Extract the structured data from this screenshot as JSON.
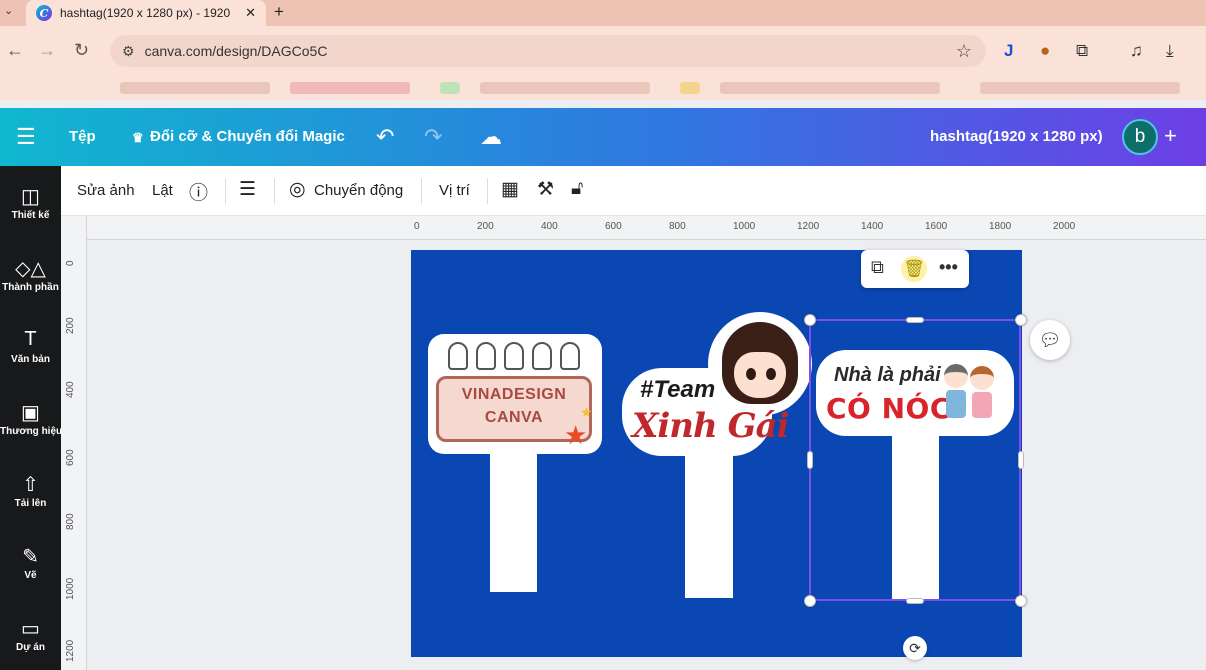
{
  "browser": {
    "tab_title": "hashtag(1920 x 1280 px) - 1920",
    "tab_close": "✕",
    "new_tab": "+",
    "url": "canva.com/design/DAGCo5C"
  },
  "topbar": {
    "menu_icon": "☰",
    "file": "Tệp",
    "magic_resize": "Đổi cỡ & Chuyển đổi Magic",
    "design_title": "hashtag(1920 x 1280 px)",
    "avatar_letter": "b",
    "add": "+"
  },
  "sidebar": {
    "items": [
      {
        "label": "Thiết kế",
        "icon": "layout-icon"
      },
      {
        "label": "Thành phần",
        "icon": "elements-icon"
      },
      {
        "label": "Văn bản",
        "icon": "text-icon"
      },
      {
        "label": "Thương hiệu",
        "icon": "brand-icon"
      },
      {
        "label": "Tải lên",
        "icon": "upload-icon"
      },
      {
        "label": "Vẽ",
        "icon": "draw-icon"
      },
      {
        "label": "Dự án",
        "icon": "folder-icon"
      }
    ]
  },
  "toolbar": {
    "edit_photo": "Sửa ảnh",
    "flip": "Lật",
    "animate": "Chuyển động",
    "position": "Vị trí"
  },
  "ruler": {
    "h_ticks": [
      "0",
      "200",
      "400",
      "600",
      "800",
      "1000",
      "1200",
      "1400",
      "1600",
      "1800",
      "2000"
    ],
    "v_ticks": [
      "0",
      "200",
      "400",
      "600",
      "800",
      "1000",
      "1200"
    ]
  },
  "stickers": {
    "sign1_line1": "VINADESIGN",
    "sign1_line2": "CANVA",
    "sign2_line1": "#Team",
    "sign2_line2": "Xinh Gái",
    "sign3_line1": "Nhà là phải",
    "sign3_line2": "CÓ NÓC"
  },
  "colors": {
    "canvas_bg": "#0a47b2",
    "selection": "#7d4ef0",
    "topbar_start": "#10b7cf",
    "topbar_end": "#6d3fe6"
  }
}
